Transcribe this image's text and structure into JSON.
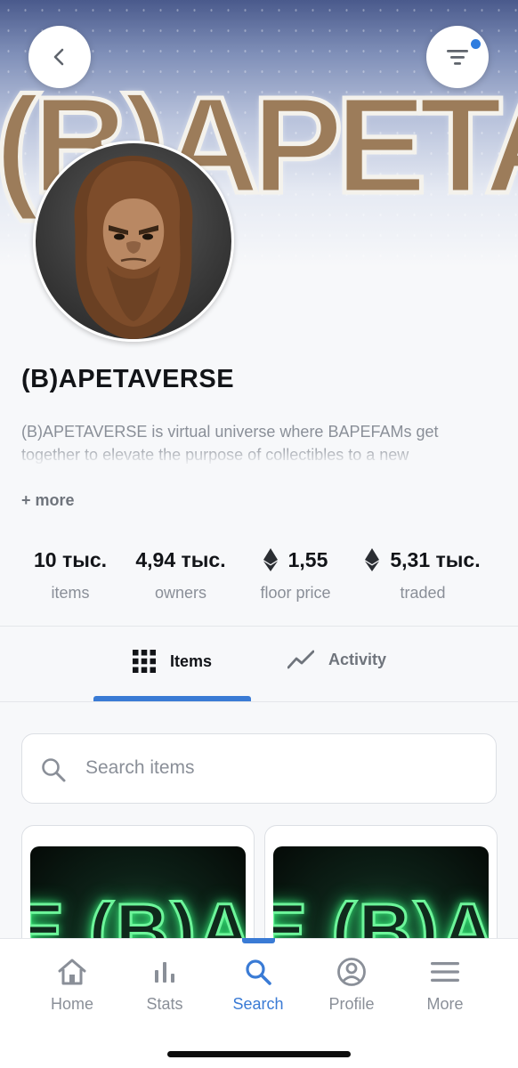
{
  "header": {
    "banner_text": "(B)APETAVERSE",
    "back_icon": "chevron-left-icon",
    "filter_icon": "filter-icon",
    "filter_has_notification": true
  },
  "collection": {
    "name": "(B)APETAVERSE",
    "description": "(B)APETAVERSE is virtual universe where BAPEFAMs get together to elevate the purpose of collectibles to a new",
    "more_label": "+ more"
  },
  "stats": [
    {
      "value": "10 тыс.",
      "label": "items",
      "eth": false
    },
    {
      "value": "4,94 тыс.",
      "label": "owners",
      "eth": false
    },
    {
      "value": "1,55",
      "label": "floor price",
      "eth": true
    },
    {
      "value": "5,31 тыс.",
      "label": "traded",
      "eth": true
    }
  ],
  "tabs": [
    {
      "label": "Items",
      "icon": "grid-icon",
      "active": true
    },
    {
      "label": "Activity",
      "icon": "activity-chart-icon",
      "active": false
    }
  ],
  "search": {
    "placeholder": "Search items"
  },
  "cards": [
    {
      "image_text": "E (B)A"
    },
    {
      "image_text": "E (B)A"
    }
  ],
  "bottom_nav": [
    {
      "label": "Home",
      "icon": "home-icon",
      "active": false
    },
    {
      "label": "Stats",
      "icon": "bar-chart-icon",
      "active": false
    },
    {
      "label": "Search",
      "icon": "search-icon",
      "active": true
    },
    {
      "label": "Profile",
      "icon": "profile-icon",
      "active": false
    },
    {
      "label": "More",
      "icon": "menu-icon",
      "active": false
    }
  ],
  "colors": {
    "accent": "#3a7bd5",
    "notification": "#2f7ddf",
    "text_primary": "#121418",
    "text_secondary": "#8a8f98"
  }
}
